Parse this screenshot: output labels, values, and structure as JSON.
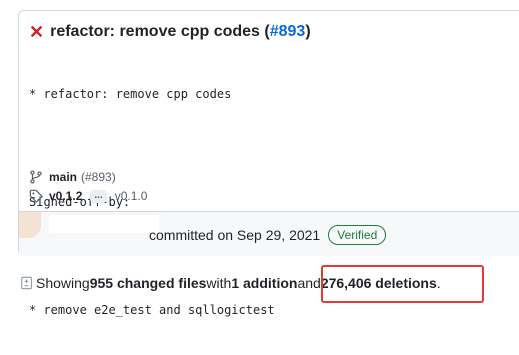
{
  "commit": {
    "title_prefix": "refactor: remove cpp codes (",
    "pr_number": "#893",
    "title_suffix": ")",
    "body_lines": [
      "* refactor: remove cpp codes",
      "",
      "Signed-off-by:",
      "",
      "* remove e2e_test and sqllogictest"
    ],
    "branch": "main",
    "branch_pr": "(#893)",
    "tag": "v0.1.2",
    "tag_more": "...",
    "tag_base": "v0.1.0",
    "committed_text": "committed on Sep 29, 2021",
    "verified_label": "Verified"
  },
  "summary": {
    "prefix": "Showing ",
    "changed_files": "955 changed files",
    "with_text": " with ",
    "additions": "1 addition",
    "and_text": " and ",
    "deletions": "276,406 deletions",
    "period": "."
  },
  "colors": {
    "status_fail": "#cf222e",
    "link": "#0969da",
    "verified": "#1a7f37",
    "highlight": "#e53935"
  }
}
